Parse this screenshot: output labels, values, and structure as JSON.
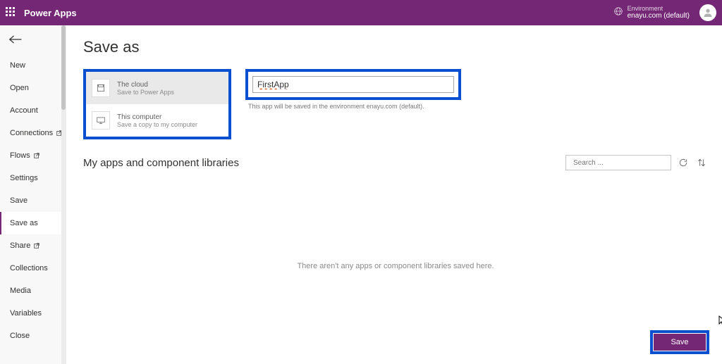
{
  "header": {
    "app_title": "Power Apps",
    "environment_label": "Environment",
    "environment_value": "enayu.com (default)"
  },
  "sidebar": {
    "items": [
      {
        "label": "New",
        "external": false,
        "active": false
      },
      {
        "label": "Open",
        "external": false,
        "active": false
      },
      {
        "label": "Account",
        "external": false,
        "active": false
      },
      {
        "label": "Connections",
        "external": true,
        "active": false
      },
      {
        "label": "Flows",
        "external": true,
        "active": false
      },
      {
        "label": "Settings",
        "external": false,
        "active": false
      },
      {
        "label": "Save",
        "external": false,
        "active": false
      },
      {
        "label": "Save as",
        "external": false,
        "active": true
      },
      {
        "label": "Share",
        "external": true,
        "active": false
      },
      {
        "label": "Collections",
        "external": false,
        "active": false
      },
      {
        "label": "Media",
        "external": false,
        "active": false
      },
      {
        "label": "Variables",
        "external": false,
        "active": false
      },
      {
        "label": "Close",
        "external": false,
        "active": false
      }
    ]
  },
  "main": {
    "page_title": "Save as",
    "locations": [
      {
        "title": "The cloud",
        "subtitle": "Save to Power Apps",
        "selected": true
      },
      {
        "title": "This computer",
        "subtitle": "Save a copy to my computer",
        "selected": false
      }
    ],
    "app_name_value": "FirstApp",
    "save_note": "This app will be saved in the environment enayu.com (default).",
    "libraries_title": "My apps and component libraries",
    "search_placeholder": "Search ...",
    "empty_message": "There aren't any apps or component libraries saved here.",
    "save_button_label": "Save"
  }
}
